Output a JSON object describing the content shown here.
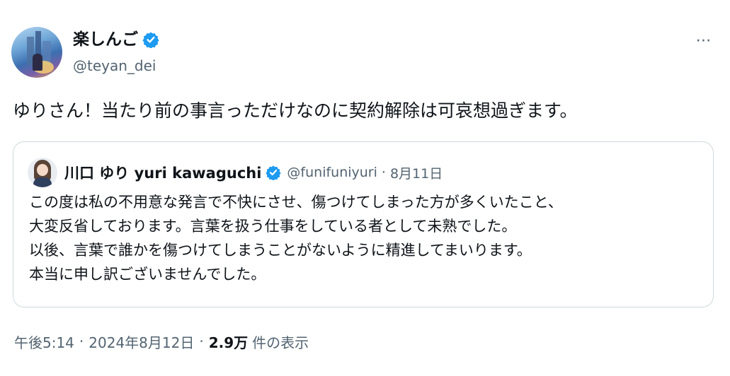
{
  "author": {
    "display_name": "楽しんご",
    "handle": "@teyan_dei",
    "verified_icon": "verified-badge-icon",
    "more_label": "⋯"
  },
  "tweet": {
    "text": "ゆりさん！当たり前の事言っただけなのに契約解除は可哀想過ぎます。"
  },
  "quote": {
    "display_name": "川口 ゆり yuri kawaguchi",
    "handle": "@funifuniyuri",
    "separator": "·",
    "date": "8月11日",
    "lines": [
      "この度は私の不用意な発言で不快にさせ、傷つけてしまった方が多くいたこと、",
      "大変反省しております。言葉を扱う仕事をしている者として未熟でした。",
      "以後、言葉で誰かを傷つけてしまうことがないように精進してまいります。",
      "本当に申し訳ございませんでした。"
    ]
  },
  "meta": {
    "time": "午後5:14",
    "separator": "·",
    "date": "2024年8月12日",
    "views_count": "2.9万",
    "views_label": "件の表示"
  },
  "colors": {
    "verified_blue": "#1d9bf0",
    "text_primary": "#0f1419",
    "text_secondary": "#536471",
    "border": "#cfd9de"
  }
}
